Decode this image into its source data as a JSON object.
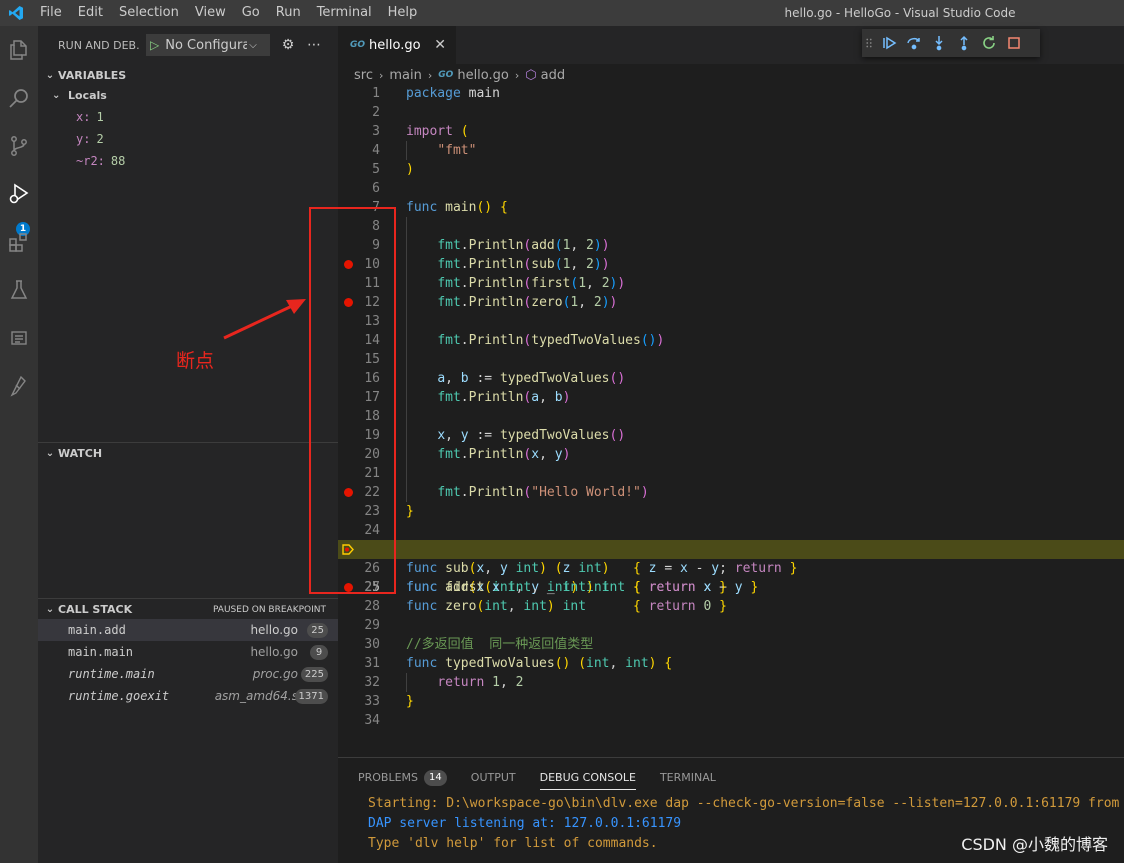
{
  "window": {
    "title": "hello.go - HelloGo - Visual Studio Code",
    "menu": [
      "File",
      "Edit",
      "Selection",
      "View",
      "Go",
      "Run",
      "Terminal",
      "Help"
    ]
  },
  "activity": {
    "icons": [
      "files-icon",
      "search-icon",
      "source-control-icon",
      "run-debug-icon",
      "extensions-icon",
      "testing-icon",
      "output-icon",
      "flask-icon"
    ],
    "debug_badge": "1"
  },
  "sidebar": {
    "title": "RUN AND DEB...",
    "config": "No Configurat",
    "variables": {
      "header": "VARIABLES",
      "scope": "Locals",
      "items": [
        {
          "name": "x:",
          "value": "1"
        },
        {
          "name": "y:",
          "value": "2"
        },
        {
          "name": "~r2:",
          "value": "88"
        }
      ]
    },
    "watch": {
      "header": "WATCH"
    },
    "callstack": {
      "header": "CALL STACK",
      "status": "PAUSED ON BREAKPOINT",
      "frames": [
        {
          "fn": "main.add",
          "file": "hello.go",
          "line": "25"
        },
        {
          "fn": "main.main",
          "file": "hello.go",
          "line": "9"
        },
        {
          "fn": "runtime.main",
          "file": "proc.go",
          "line": "225"
        },
        {
          "fn": "runtime.goexit",
          "file": "asm_amd64.s",
          "line": "1371"
        }
      ]
    }
  },
  "editor": {
    "tab": "hello.go",
    "breadcrumb": [
      "src",
      "main",
      "hello.go",
      "add"
    ],
    "line_numbers": [
      "1",
      "2",
      "3",
      "4",
      "5",
      "6",
      "7",
      "8",
      "9",
      "10",
      "11",
      "12",
      "13",
      "14",
      "15",
      "16",
      "17",
      "18",
      "19",
      "20",
      "21",
      "22",
      "23",
      "24",
      "25",
      "26",
      "27",
      "28",
      "29",
      "30",
      "31",
      "32",
      "33",
      "34"
    ],
    "breakpoint_lines": [
      10,
      12,
      22,
      27
    ],
    "current_line": 25,
    "comment_line": "//多返回值  同一种返回值类型"
  },
  "annotation": {
    "label": "断点",
    "color": "#e8261e"
  },
  "panel": {
    "tabs": [
      "PROBLEMS",
      "OUTPUT",
      "DEBUG CONSOLE",
      "TERMINAL"
    ],
    "problems_count": "14",
    "active_tab": "DEBUG CONSOLE",
    "console": [
      "Starting: D:\\workspace-go\\bin\\dlv.exe dap --check-go-version=false --listen=127.0.0.1:61179 from d",
      "DAP server listening at: 127.0.0.1:61179",
      "Type 'dlv help' for list of commands."
    ]
  },
  "watermark": "CSDN @小魏的博客"
}
